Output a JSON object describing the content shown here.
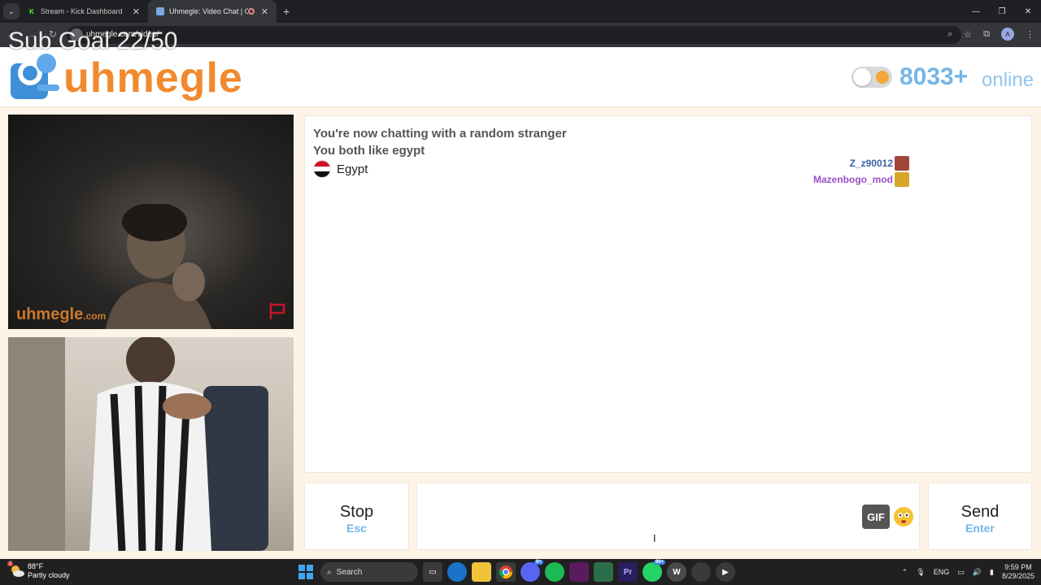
{
  "browser": {
    "tabs": [
      {
        "title": "Stream - Kick Dashboard",
        "active": false
      },
      {
        "title": "Uhmegle: Video Chat | Ome",
        "active": true
      }
    ],
    "new_tab": "+",
    "url": "uhmegle.com/video/",
    "overlay_text": "Sub Goal 22/50",
    "profile_initial": "A"
  },
  "site": {
    "logo_text": "uhmegle",
    "online_count": "8033+",
    "online_label": "online",
    "accent_color": "#f18a2f",
    "secondary_color": "#74b6e8"
  },
  "video": {
    "watermark": "uhmegle",
    "watermark_suffix": ".com"
  },
  "chat": {
    "system_lines": [
      "You're now chatting with a random stranger",
      "You both like egypt"
    ],
    "country": "Egypt",
    "viewers": [
      {
        "name": "Z_z90012",
        "color": "#3b5fa8"
      },
      {
        "name": "Mazenbogo_mod",
        "color": "#9b4fc9"
      }
    ]
  },
  "controls": {
    "stop_label": "Stop",
    "stop_key": "Esc",
    "send_label": "Send",
    "send_key": "Enter",
    "gif_label": "GIF",
    "cursor_glyph": "I"
  },
  "taskbar": {
    "weather_badge": "2",
    "temperature": "88°F",
    "condition": "Partly cloudy",
    "search_label": "Search",
    "discord_badge": "9+",
    "whatsapp_badge": "99+",
    "language": "ENG",
    "time": "9:59 PM",
    "date": "8/29/2025"
  }
}
